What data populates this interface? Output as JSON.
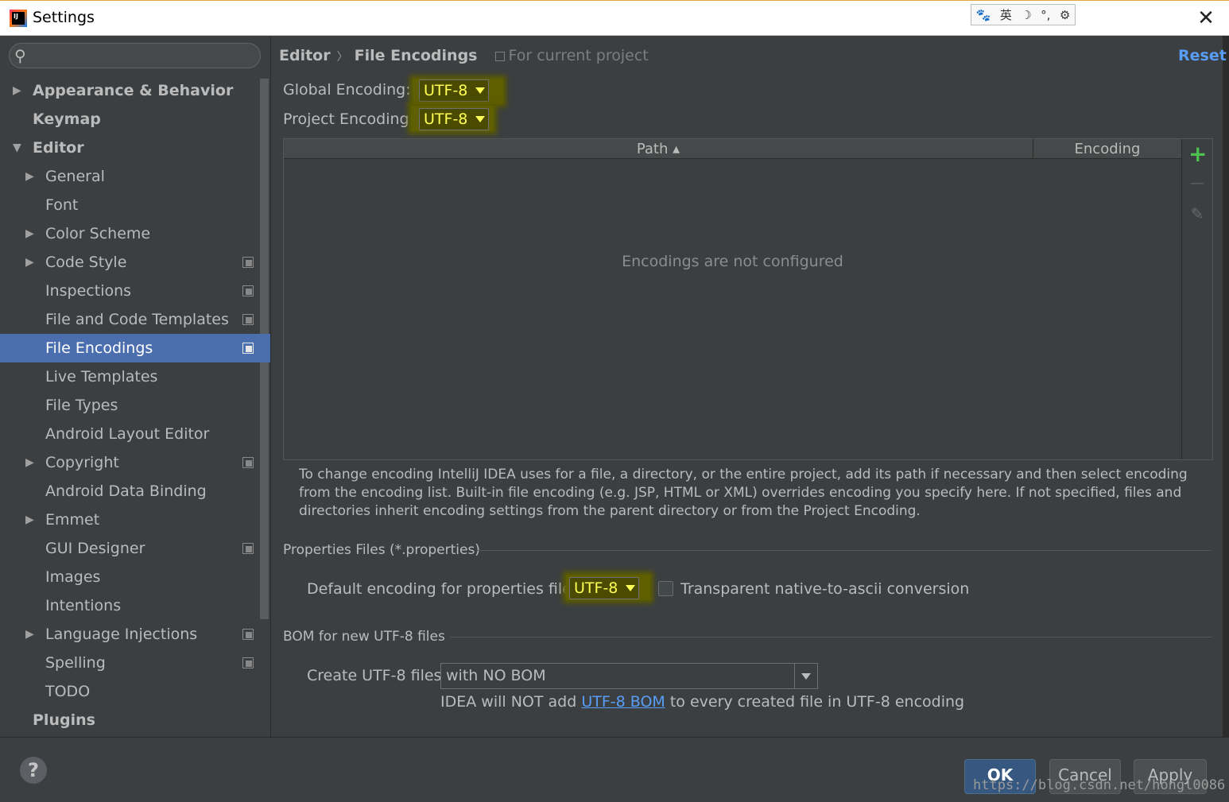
{
  "window": {
    "title": "Settings",
    "ime_items": [
      "🐾",
      "英",
      "☽",
      "°,",
      "⚙"
    ]
  },
  "search": {
    "placeholder": ""
  },
  "sidebar": {
    "items": [
      {
        "label": "Appearance & Behavior",
        "level": 0,
        "arrow": "right",
        "bold": true,
        "project": false,
        "selected": false
      },
      {
        "label": "Keymap",
        "level": 0,
        "arrow": "none",
        "bold": true,
        "project": false,
        "selected": false
      },
      {
        "label": "Editor",
        "level": 0,
        "arrow": "down",
        "bold": true,
        "project": false,
        "selected": false
      },
      {
        "label": "General",
        "level": 1,
        "arrow": "right",
        "bold": false,
        "project": false,
        "selected": false
      },
      {
        "label": "Font",
        "level": 1,
        "arrow": "none",
        "bold": false,
        "project": false,
        "selected": false
      },
      {
        "label": "Color Scheme",
        "level": 1,
        "arrow": "right",
        "bold": false,
        "project": false,
        "selected": false
      },
      {
        "label": "Code Style",
        "level": 1,
        "arrow": "right",
        "bold": false,
        "project": true,
        "selected": false
      },
      {
        "label": "Inspections",
        "level": 1,
        "arrow": "none",
        "bold": false,
        "project": true,
        "selected": false
      },
      {
        "label": "File and Code Templates",
        "level": 1,
        "arrow": "none",
        "bold": false,
        "project": true,
        "selected": false
      },
      {
        "label": "File Encodings",
        "level": 1,
        "arrow": "none",
        "bold": false,
        "project": true,
        "selected": true
      },
      {
        "label": "Live Templates",
        "level": 1,
        "arrow": "none",
        "bold": false,
        "project": false,
        "selected": false
      },
      {
        "label": "File Types",
        "level": 1,
        "arrow": "none",
        "bold": false,
        "project": false,
        "selected": false
      },
      {
        "label": "Android Layout Editor",
        "level": 1,
        "arrow": "none",
        "bold": false,
        "project": false,
        "selected": false
      },
      {
        "label": "Copyright",
        "level": 1,
        "arrow": "right",
        "bold": false,
        "project": true,
        "selected": false
      },
      {
        "label": "Android Data Binding",
        "level": 1,
        "arrow": "none",
        "bold": false,
        "project": false,
        "selected": false
      },
      {
        "label": "Emmet",
        "level": 1,
        "arrow": "right",
        "bold": false,
        "project": false,
        "selected": false
      },
      {
        "label": "GUI Designer",
        "level": 1,
        "arrow": "none",
        "bold": false,
        "project": true,
        "selected": false
      },
      {
        "label": "Images",
        "level": 1,
        "arrow": "none",
        "bold": false,
        "project": false,
        "selected": false
      },
      {
        "label": "Intentions",
        "level": 1,
        "arrow": "none",
        "bold": false,
        "project": false,
        "selected": false
      },
      {
        "label": "Language Injections",
        "level": 1,
        "arrow": "right",
        "bold": false,
        "project": true,
        "selected": false
      },
      {
        "label": "Spelling",
        "level": 1,
        "arrow": "none",
        "bold": false,
        "project": true,
        "selected": false
      },
      {
        "label": "TODO",
        "level": 1,
        "arrow": "none",
        "bold": false,
        "project": false,
        "selected": false
      },
      {
        "label": "Plugins",
        "level": 0,
        "arrow": "none",
        "bold": true,
        "project": false,
        "selected": false
      }
    ]
  },
  "breadcrumb": {
    "parent": "Editor",
    "separator": "〉",
    "current": "File Encodings",
    "scope": "For current project"
  },
  "reset_label": "Reset",
  "encodings": {
    "global_label": "Global Encoding:",
    "global_value": "UTF-8",
    "project_label": "Project Encoding:",
    "project_value": "UTF-8"
  },
  "table": {
    "columns": [
      "Path ▴",
      "Encoding"
    ],
    "empty_text": "Encodings are not configured",
    "toolbar": {
      "add": "+",
      "remove": "—",
      "edit": "✎"
    }
  },
  "description": "To change encoding IntelliJ IDEA uses for a file, a directory, or the entire project, add its path if necessary and then select encoding from the encoding list. Built-in file encoding (e.g. JSP, HTML or XML) overrides encoding you specify here. If not specified, files and directories inherit encoding settings from the parent directory or from the Project Encoding.",
  "properties": {
    "section_title": "Properties Files (*.properties)",
    "default_label": "Default encoding for properties files:",
    "default_value": "UTF-8",
    "transparent_label": "Transparent native-to-ascii conversion",
    "transparent_checked": false
  },
  "bom": {
    "section_title": "BOM for new UTF-8 files",
    "create_label": "Create UTF-8 files:",
    "create_value": "with NO BOM",
    "note_prefix": "IDEA will NOT add ",
    "note_link": "UTF-8 BOM",
    "note_suffix": " to every created file in UTF-8 encoding"
  },
  "buttons": {
    "help": "?",
    "ok": "OK",
    "cancel": "Cancel",
    "apply": "Apply"
  },
  "watermark": "https://blog.csdn.net/hongl0086",
  "colors": {
    "accent_link": "#589df6",
    "selection": "#4b6eaf",
    "highlight_text": "#ffff55",
    "background": "#3c3f41"
  }
}
